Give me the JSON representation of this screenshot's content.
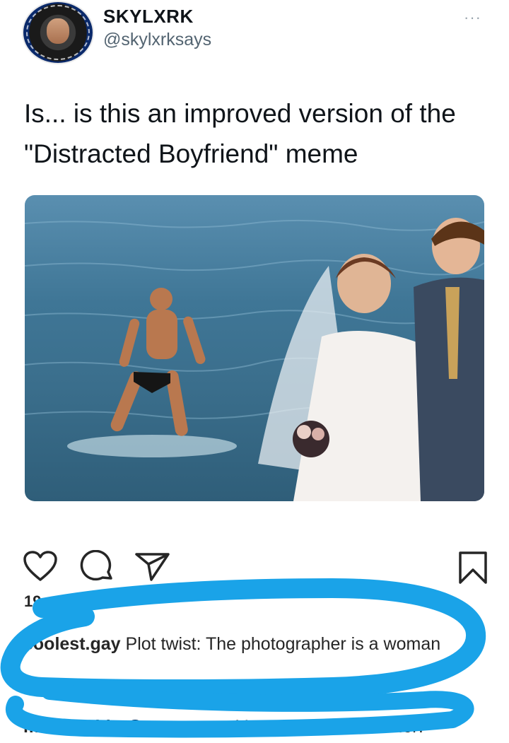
{
  "tweet": {
    "display_name": "SKYLXRK",
    "handle": "@skylxrksays",
    "more": "···",
    "text": "Is... is this an improved version of the \"Distracted Boyfriend\" meme"
  },
  "post": {
    "likes": "19",
    "view_all": "comments",
    "comments": [
      {
        "user": "coolest.gay",
        "text": "Plot twist: The photographer is a woman"
      },
      {
        "user": "miamafalda",
        "mention": "@scenemeat",
        "text": "It’s not a headcanon lol?"
      }
    ]
  },
  "colors": {
    "marker": "#1aa3e8",
    "handle": "#536471",
    "mention": "#00376b"
  },
  "icons": [
    "heart-icon",
    "comment-icon",
    "share-icon",
    "bookmark-icon",
    "more-icon"
  ]
}
